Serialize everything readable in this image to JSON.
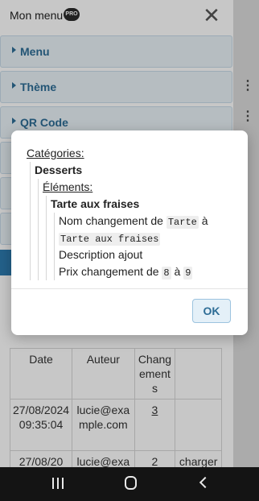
{
  "menu": {
    "title": "Mon menu",
    "badge": "PRO",
    "close_glyph": "✕",
    "sections": [
      {
        "label": "Menu"
      },
      {
        "label": "Thème"
      },
      {
        "label": "QR Code"
      }
    ]
  },
  "history_table": {
    "headers": [
      "Date",
      "Auteur",
      "Changements",
      ""
    ],
    "rows": [
      [
        "27/08/2024 09:35:04",
        "lucie@example.com",
        "3",
        ""
      ],
      [
        "27/08/20",
        "lucie@exa",
        "2",
        "charger"
      ]
    ]
  },
  "dialog": {
    "categories_label": "Catégories:",
    "category_name": "Desserts",
    "elements_label": "Éléments:",
    "element_name": "Tarte aux fraises",
    "change1": {
      "prefix": "Nom changement de",
      "from": "Tarte",
      "mid": "à",
      "to": "Tarte aux fraises"
    },
    "change2": {
      "text": "Description ajout"
    },
    "change3": {
      "prefix": "Prix changement de",
      "from": "8",
      "mid": "à",
      "to": "9"
    },
    "ok_label": "OK"
  },
  "icons": {
    "close": "close-icon",
    "caret": "caret-right-icon",
    "more": "more-vertical-icon",
    "recent_apps": "recent-apps-icon",
    "home": "home-icon",
    "back": "back-icon"
  },
  "colors": {
    "accent": "#2e6d96",
    "accordion_bg": "#e9f2f8",
    "nav_bar": "#141414"
  }
}
